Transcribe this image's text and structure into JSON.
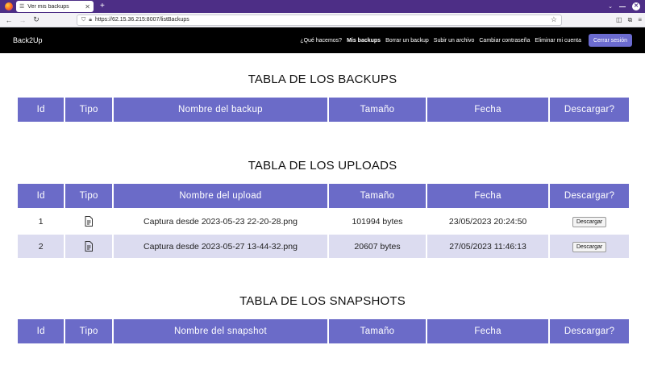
{
  "browser": {
    "tab_title": "Ver mis backups",
    "url": "https://62.15.36.215:8007/listBackups"
  },
  "app": {
    "brand": "Back2Up",
    "menu": [
      {
        "label": "¿Qué hacemos?"
      },
      {
        "label": "Mis backups"
      },
      {
        "label": "Borrar un backup"
      },
      {
        "label": "Subir un archivo"
      },
      {
        "label": "Cambiar contraseña"
      },
      {
        "label": "Eliminar mi cuenta"
      }
    ],
    "logout_label": "Cerrar sesión"
  },
  "backups": {
    "title": "TABLA DE LOS BACKUPS",
    "headers": [
      "Id",
      "Tipo",
      "Nombre del backup",
      "Tamaño",
      "Fecha",
      "Descargar?"
    ]
  },
  "uploads": {
    "title": "TABLA DE LOS UPLOADS",
    "headers": [
      "Id",
      "Tipo",
      "Nombre del upload",
      "Tamaño",
      "Fecha",
      "Descargar?"
    ],
    "rows": [
      {
        "id": "1",
        "icon": "file-icon",
        "name": "Captura desde 2023-05-23 22-20-28.png",
        "size": "101994 bytes",
        "date": "23/05/2023 20:24:50",
        "action": "Descargar"
      },
      {
        "id": "2",
        "icon": "file-icon",
        "name": "Captura desde 2023-05-27 13-44-32.png",
        "size": "20607 bytes",
        "date": "27/05/2023 11:46:13",
        "action": "Descargar"
      }
    ]
  },
  "snapshots": {
    "title": "TABLA DE LOS SNAPSHOTS",
    "headers": [
      "Id",
      "Tipo",
      "Nombre del snapshot",
      "Tamaño",
      "Fecha",
      "Descargar?"
    ]
  },
  "colors": {
    "header_bg": "#6b6bc8",
    "row_alt_bg": "#dcdcf0",
    "appbar_bg": "#000000",
    "logout_bg": "#6b6bd0",
    "browser_frame": "#4d2e86"
  }
}
